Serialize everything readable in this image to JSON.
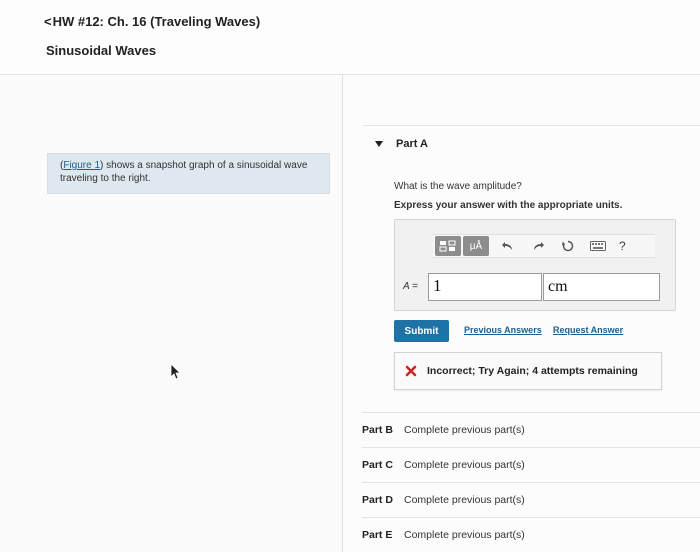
{
  "header": {
    "back_chevron": "<",
    "assignment_title": "HW #12: Ch. 16 (Traveling Waves)"
  },
  "page": {
    "title": "Sinusoidal Waves"
  },
  "figure_prompt": {
    "link_text": "Figure 1",
    "before_link": "(",
    "after_link": ") shows a snapshot graph of a sinusoidal wave traveling to the right."
  },
  "part_a": {
    "label": "Part A",
    "question": "What is the wave amplitude?",
    "instruction": "Express your answer with the appropriate units.",
    "toolbar": {
      "buttons": [
        "templates-icon",
        "mu-A-icon",
        "undo-icon",
        "redo-icon",
        "reset-icon",
        "keyboard-icon",
        "help-icon"
      ],
      "mu_label": "μÅ",
      "help_label": "?"
    },
    "answer": {
      "variable_label": "A",
      "equals": "=",
      "value": "1",
      "units": "cm"
    },
    "submit_label": "Submit",
    "previous_answers_label": "Previous Answers",
    "request_answer_label": "Request Answer",
    "feedback": "Incorrect; Try Again; 4 attempts remaining"
  },
  "parts": [
    {
      "label": "Part B",
      "status": "Complete previous part(s)"
    },
    {
      "label": "Part C",
      "status": "Complete previous part(s)"
    },
    {
      "label": "Part D",
      "status": "Complete previous part(s)"
    },
    {
      "label": "Part E",
      "status": "Complete previous part(s)"
    }
  ],
  "colors": {
    "accent": "#1d73a6",
    "link": "#1f5d8c",
    "figure_box": "#dde9ee",
    "error": "#c62828"
  }
}
